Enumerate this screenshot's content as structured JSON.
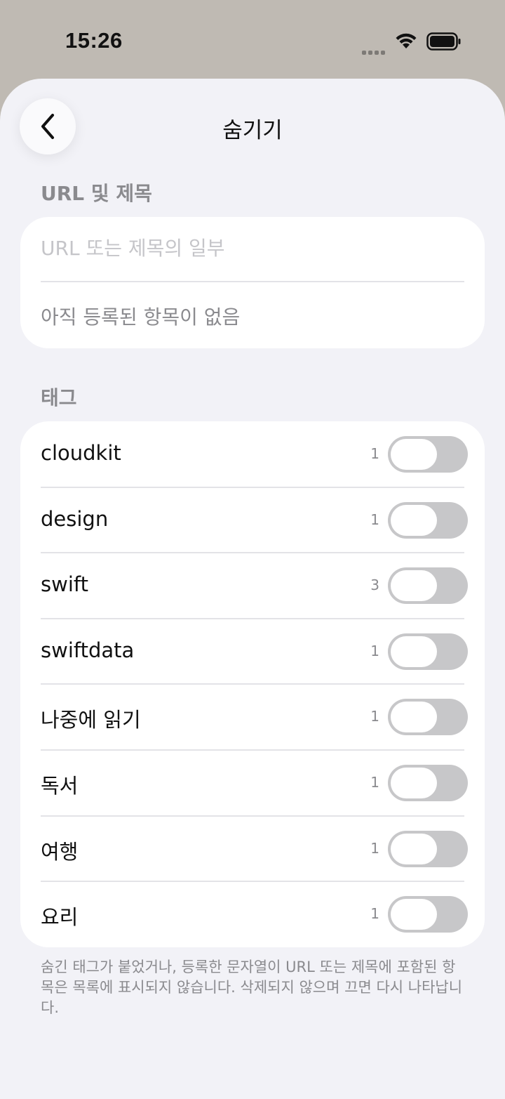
{
  "status_bar": {
    "time": "15:26",
    "icons": [
      "cellular-signal-icon",
      "wifi-icon",
      "battery-icon"
    ]
  },
  "nav": {
    "back_icon": "chevron-left-icon",
    "title": "숨기기"
  },
  "url_section": {
    "header": "URL 및 제목",
    "input_placeholder": "URL 또는 제목의 일부",
    "input_value": "",
    "empty_text": "아직 등록된 항목이 없음"
  },
  "tag_section": {
    "header": "태그",
    "tags": [
      {
        "label": "cloudkit",
        "count": "1",
        "hidden": false
      },
      {
        "label": "design",
        "count": "1",
        "hidden": false
      },
      {
        "label": "swift",
        "count": "3",
        "hidden": false
      },
      {
        "label": "swiftdata",
        "count": "1",
        "hidden": false
      },
      {
        "label": "나중에 읽기",
        "count": "1",
        "hidden": false
      },
      {
        "label": "독서",
        "count": "1",
        "hidden": false
      },
      {
        "label": "여행",
        "count": "1",
        "hidden": false
      },
      {
        "label": "요리",
        "count": "1",
        "hidden": false
      }
    ]
  },
  "footer_note": "숨긴 태그가 붙었거나, 등록한 문자열이 URL 또는 제목에 포함된 항목은 목록에 표시되지 않습니다. 삭제되지 않으며 끄면 다시 나타납니다.",
  "colors": {
    "background": "#f2f2f7",
    "card": "#ffffff",
    "toggle_off": "#c7c7c9",
    "secondary_text": "#8a8a8e"
  }
}
